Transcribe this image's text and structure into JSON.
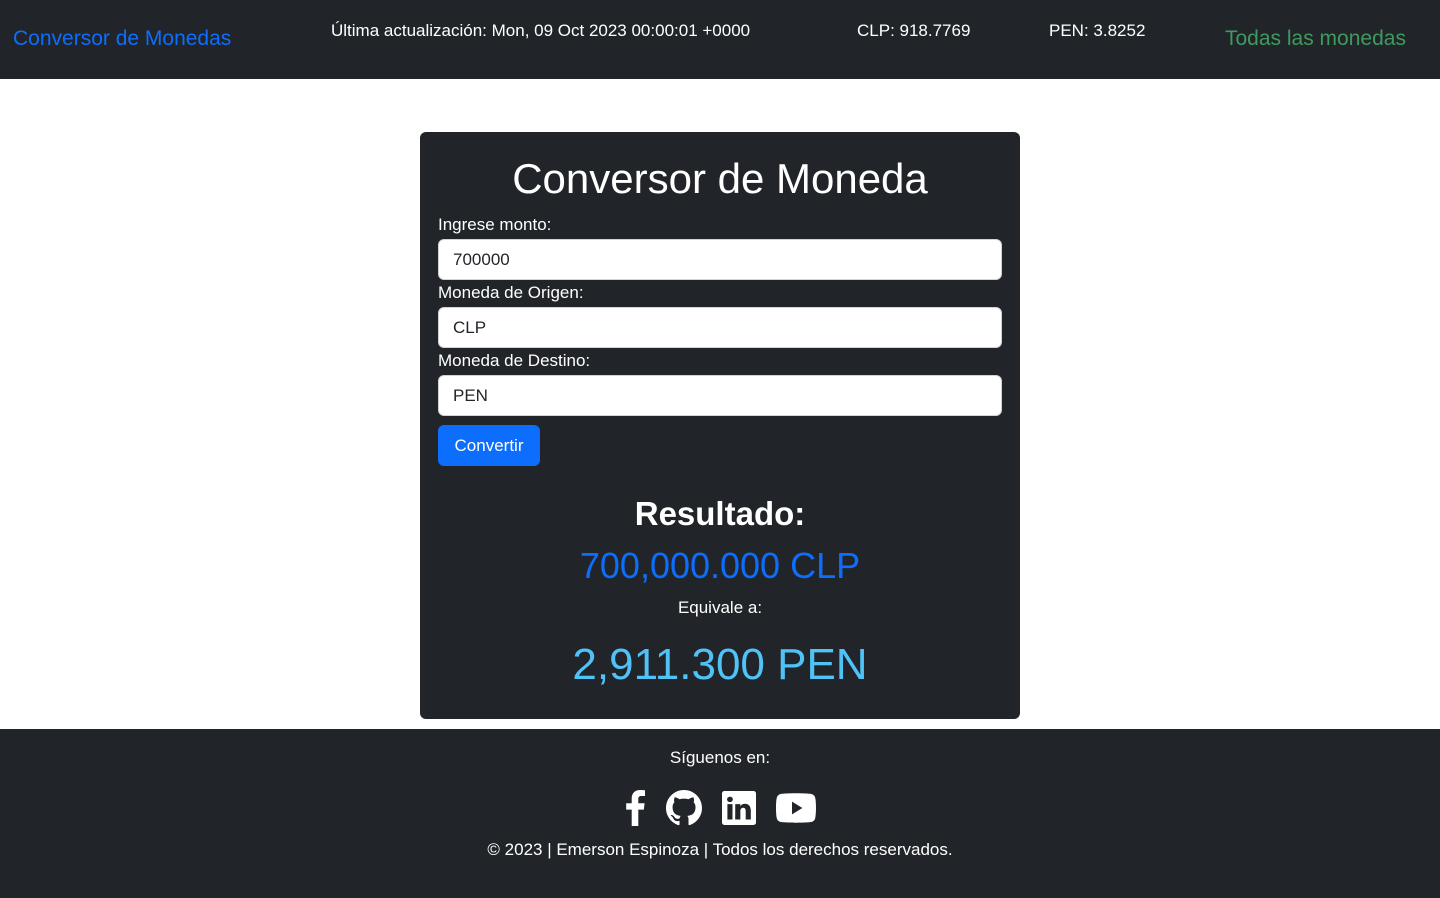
{
  "header": {
    "brand": "Conversor de Monedas",
    "updated": "Última actualización: Mon, 09 Oct 2023 00:00:01 +0000",
    "rate_clp": "CLP: 918.7769",
    "rate_pen": "PEN: 3.8252",
    "all_currencies": "Todas las monedas"
  },
  "converter": {
    "title": "Conversor de Moneda",
    "amount_label": "Ingrese monto:",
    "amount_value": "700000",
    "from_label": "Moneda de Origen:",
    "from_value": "CLP",
    "to_label": "Moneda de Destino:",
    "to_value": "PEN",
    "convert_button": "Convertir"
  },
  "result": {
    "heading": "Resultado:",
    "from_amount": "700,000.000 CLP",
    "equivalent_label": "Equivale a:",
    "to_amount": "2,911.300 PEN"
  },
  "footer": {
    "follow": "Síguenos en:",
    "socials": [
      "facebook-icon",
      "github-icon",
      "linkedin-icon",
      "youtube-icon"
    ],
    "copyright": "© 2023 | Emerson Espinoza | Todos los derechos reservados."
  },
  "colors": {
    "dark": "#212529",
    "primary": "#0d6efd",
    "success": "#3f9a5e",
    "info": "#4fc3f7"
  }
}
